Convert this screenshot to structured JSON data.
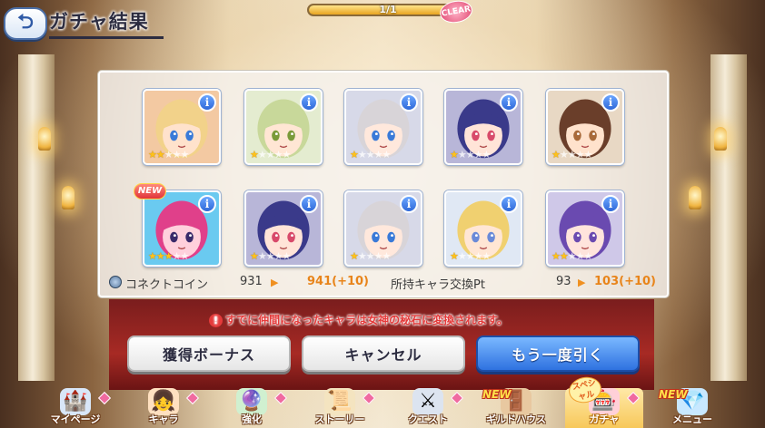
{
  "header": {
    "back_icon": "back-arrow-icon",
    "title": "ガチャ結果",
    "progress_text": "1/1",
    "progress_fraction": 1.0,
    "clear_badge": "CLEAR"
  },
  "cards": [
    {
      "stars": 2,
      "max_stars": 5,
      "is_new": false,
      "hair": "#f2d28a",
      "skin": "#ffe2cc",
      "bg": "#f3c9a2",
      "eye": "#3a7ad8"
    },
    {
      "stars": 1,
      "max_stars": 5,
      "is_new": false,
      "hair": "#c8d89a",
      "skin": "#ffe6d4",
      "bg": "#e4ecd0",
      "eye": "#7a9a3a"
    },
    {
      "stars": 1,
      "max_stars": 5,
      "is_new": false,
      "hair": "#d8d4d8",
      "skin": "#ffe8dc",
      "bg": "#d7d9e8",
      "eye": "#3a7ad8"
    },
    {
      "stars": 1,
      "max_stars": 5,
      "is_new": false,
      "hair": "#3a3a8a",
      "skin": "#ffe4d8",
      "bg": "#b8b6d8",
      "eye": "#d84a6a"
    },
    {
      "stars": 1,
      "max_stars": 5,
      "is_new": false,
      "hair": "#6a3e2a",
      "skin": "#ffe2cc",
      "bg": "#e8d8c4",
      "eye": "#a86a3a"
    },
    {
      "stars": 3,
      "max_stars": 5,
      "is_new": true,
      "hair": "#e0408a",
      "skin": "#ffd0dc",
      "bg": "#6acaf0",
      "eye": "#3a2a6a"
    },
    {
      "stars": 1,
      "max_stars": 5,
      "is_new": false,
      "hair": "#3a3a8a",
      "skin": "#ffe4d8",
      "bg": "#b8b6d8",
      "eye": "#d84a6a"
    },
    {
      "stars": 1,
      "max_stars": 5,
      "is_new": false,
      "hair": "#d8d4d8",
      "skin": "#ffe8dc",
      "bg": "#d7d9e8",
      "eye": "#3a7ad8"
    },
    {
      "stars": 1,
      "max_stars": 5,
      "is_new": false,
      "hair": "#f0d070",
      "skin": "#ffe6d4",
      "bg": "#e0e8f4",
      "eye": "#6a8ad8"
    },
    {
      "stars": 2,
      "max_stars": 5,
      "is_new": false,
      "hair": "#6a4ab0",
      "skin": "#ffe4dc",
      "bg": "#cfc8e8",
      "eye": "#6a4ab0"
    }
  ],
  "new_label": "NEW",
  "info_label": "i",
  "rewards": {
    "coin_icon": "connect-coin-icon",
    "coin_label": "コネクトコイン",
    "coin_before": "931",
    "coin_after": "941(+10)",
    "pt_label": "所持キャラ交換Pt",
    "pt_before": "93",
    "pt_after": "103(+10)",
    "arrow": "▶"
  },
  "warning": {
    "icon": "!",
    "text": "すでに仲間になったキャラは女神の秘石に変換されます。"
  },
  "buttons": {
    "bonus": "獲得ボーナス",
    "cancel": "キャンセル",
    "draw_again": "もう一度引く"
  },
  "nav": [
    {
      "label": "マイページ",
      "icon": "castle-icon",
      "glyph": "🏰",
      "color": "#d8e6f8",
      "active": false,
      "gem": true,
      "is_new": false
    },
    {
      "label": "キャラ",
      "icon": "character-icon",
      "glyph": "👧",
      "color": "#ffe0c0",
      "active": false,
      "gem": true,
      "is_new": false
    },
    {
      "label": "強化",
      "icon": "enhance-orbs-icon",
      "glyph": "🔮",
      "color": "#d0f0d0",
      "active": false,
      "gem": true,
      "is_new": false
    },
    {
      "label": "ストーリー",
      "icon": "scroll-icon",
      "glyph": "📜",
      "color": "#f4e4c0",
      "active": false,
      "gem": true,
      "is_new": false
    },
    {
      "label": "クエスト",
      "icon": "sword-shield-icon",
      "glyph": "⚔",
      "color": "#dce4f0",
      "active": false,
      "gem": true,
      "is_new": false
    },
    {
      "label": "ギルドハウス",
      "icon": "guild-door-icon",
      "glyph": "🚪",
      "color": "#e8c8a0",
      "active": false,
      "gem": false,
      "is_new": true
    },
    {
      "label": "ガチャ",
      "icon": "gacha-machine-icon",
      "glyph": "🎰",
      "color": "#ffd0d8",
      "active": true,
      "gem": true,
      "is_new": false
    },
    {
      "label": "メニュー",
      "icon": "crystal-icon",
      "glyph": "💎",
      "color": "#c8e8ff",
      "active": false,
      "gem": false,
      "is_new": true
    }
  ],
  "special_tag": "スペシャル",
  "colors": {
    "accent_blue": "#2f72e0",
    "warning_red": "#e43a3a",
    "reward_orange": "#e8841a",
    "star_gold": "#ffc21a"
  }
}
